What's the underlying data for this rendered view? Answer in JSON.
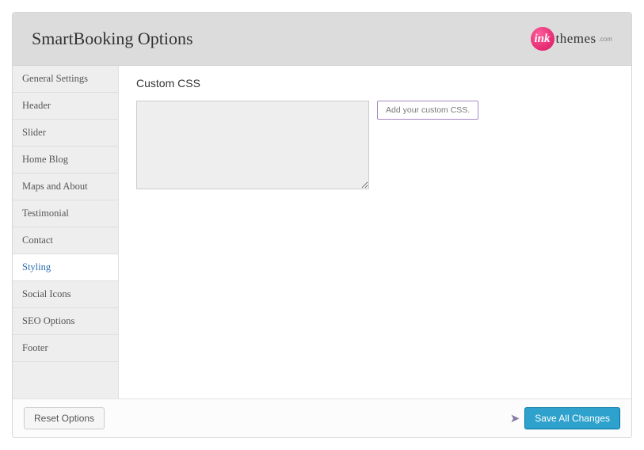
{
  "header": {
    "title": "SmartBooking Options",
    "logo_badge": "ink",
    "logo_text": "themes",
    "logo_sub": ".com"
  },
  "sidebar": {
    "items": [
      {
        "label": "General Settings"
      },
      {
        "label": "Header"
      },
      {
        "label": "Slider"
      },
      {
        "label": "Home Blog"
      },
      {
        "label": "Maps and About"
      },
      {
        "label": "Testimonial"
      },
      {
        "label": "Contact"
      },
      {
        "label": "Styling"
      },
      {
        "label": "Social Icons"
      },
      {
        "label": "SEO Options"
      },
      {
        "label": "Footer"
      }
    ],
    "active_index": 7
  },
  "content": {
    "section_title": "Custom CSS",
    "textarea_value": "",
    "help_text": "Add your custom CSS."
  },
  "footer": {
    "reset_label": "Reset Options",
    "save_label": "Save All Changes"
  }
}
